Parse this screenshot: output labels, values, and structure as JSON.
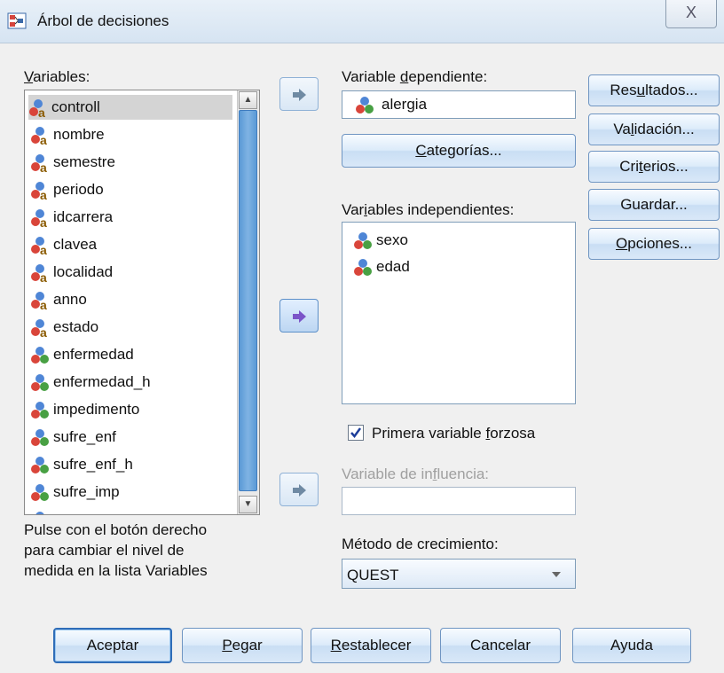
{
  "window": {
    "title": "Árbol de decisiones",
    "close_symbol": "X"
  },
  "variables": {
    "label_prefix": "V",
    "label_rest": "ariables:",
    "items": [
      {
        "name": "controll",
        "type": "nominal-string"
      },
      {
        "name": "nombre",
        "type": "nominal-string"
      },
      {
        "name": "semestre",
        "type": "nominal-string"
      },
      {
        "name": "periodo",
        "type": "nominal-string"
      },
      {
        "name": "idcarrera",
        "type": "nominal-string"
      },
      {
        "name": "clavea",
        "type": "nominal-string"
      },
      {
        "name": "localidad",
        "type": "nominal-string"
      },
      {
        "name": "anno",
        "type": "nominal-string"
      },
      {
        "name": "estado",
        "type": "nominal-string"
      },
      {
        "name": "enfermedad",
        "type": "nominal"
      },
      {
        "name": "enfermedad_h",
        "type": "nominal"
      },
      {
        "name": "impedimento",
        "type": "nominal"
      },
      {
        "name": "sufre_enf",
        "type": "nominal"
      },
      {
        "name": "sufre_enf_h",
        "type": "nominal"
      },
      {
        "name": "sufre_imp",
        "type": "nominal"
      }
    ],
    "selected": "controll"
  },
  "help_text": [
    "Pulse con el botón derecho",
    "para cambiar el nivel de",
    "medida en la lista Variables"
  ],
  "dependent": {
    "label_a": "Variable ",
    "label_u": "d",
    "label_b": "ependiente:",
    "value": "alergia"
  },
  "categories_button": {
    "u": "C",
    "rest": "ategorías..."
  },
  "independent": {
    "label_a": "Var",
    "label_u": "i",
    "label_b": "ables independientes:",
    "items": [
      "sexo",
      "edad"
    ]
  },
  "force_first": {
    "checked": true,
    "label_a": "Primera variable ",
    "label_u": "f",
    "label_b": "orzosa"
  },
  "influence": {
    "label_a": "Variable de in",
    "label_u": "f",
    "label_b": "luencia:",
    "value": ""
  },
  "growth": {
    "label": "Método de crecimiento:",
    "value": "QUEST"
  },
  "side_buttons": [
    {
      "a": "Res",
      "u": "u",
      "b": "ltados..."
    },
    {
      "a": "Va",
      "u": "l",
      "b": "idación..."
    },
    {
      "a": "Cri",
      "u": "t",
      "b": "erios..."
    },
    {
      "a": "Guardar...",
      "u": "",
      "b": ""
    },
    {
      "a": "",
      "u": "O",
      "b": "pciones..."
    }
  ],
  "bottom_buttons": [
    {
      "a": "Aceptar",
      "u": "",
      "b": ""
    },
    {
      "a": "",
      "u": "P",
      "b": "egar"
    },
    {
      "a": "",
      "u": "R",
      "b": "establecer"
    },
    {
      "a": "Cancelar",
      "u": "",
      "b": ""
    },
    {
      "a": "Ayuda",
      "u": "",
      "b": ""
    }
  ],
  "icons": {
    "app": "decision-tree-icon",
    "nominal_string": "nominal-string-variable-icon",
    "nominal": "nominal-variable-icon",
    "arrow": "move-right-arrow-icon"
  }
}
